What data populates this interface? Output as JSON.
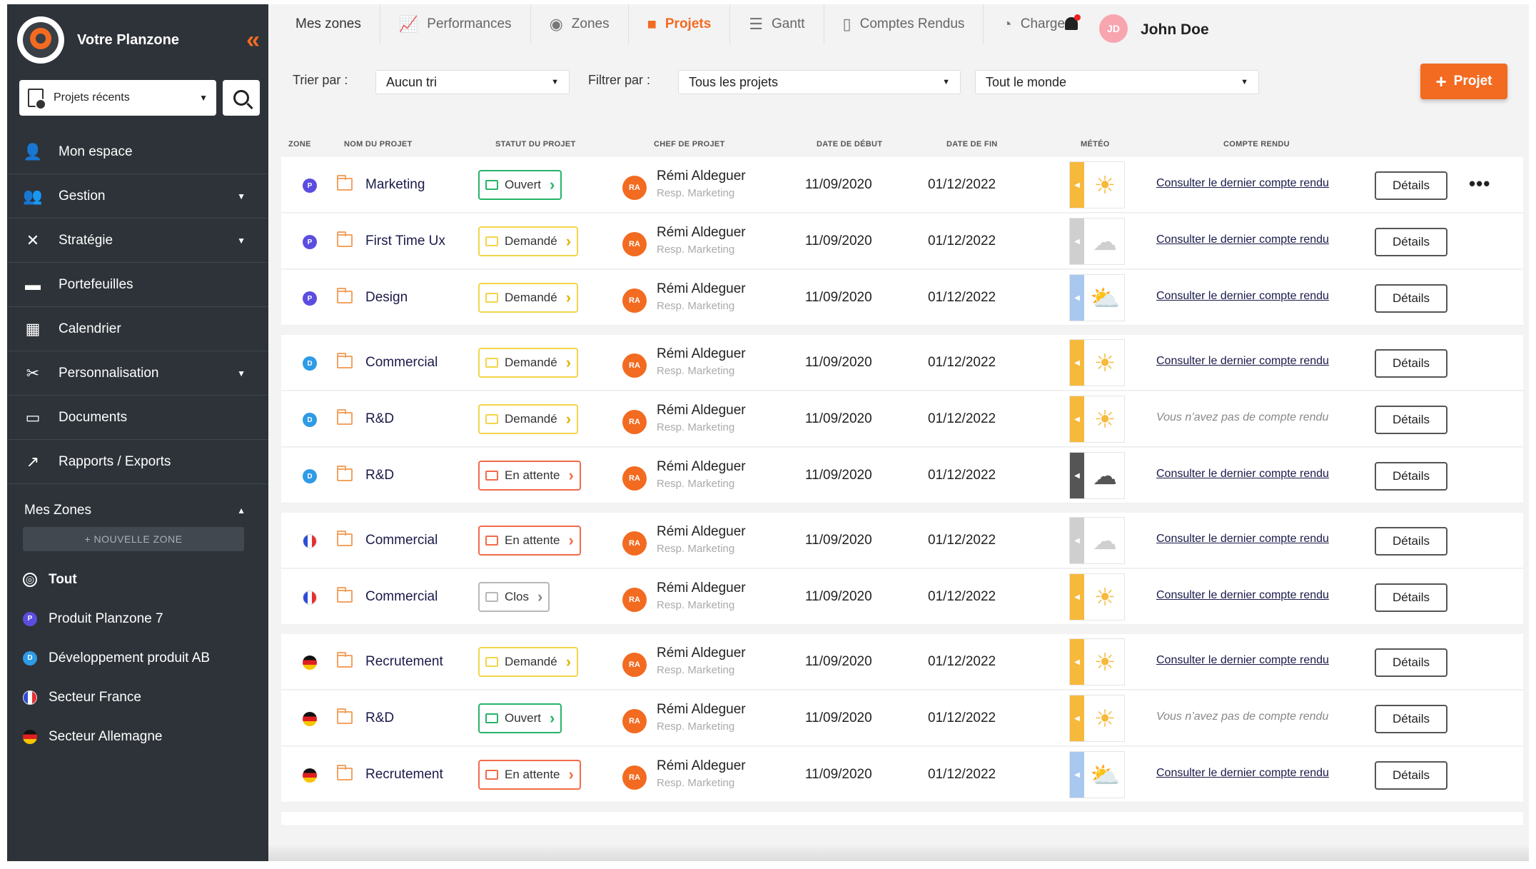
{
  "brand": {
    "name": "Votre Planzone"
  },
  "sidebar": {
    "recent_label": "Projets récents",
    "items": [
      {
        "label": "Mon espace",
        "icon": "user-lock-icon",
        "glyph": "👤",
        "dropdown": false
      },
      {
        "label": "Gestion",
        "icon": "users-cog-icon",
        "glyph": "👥",
        "dropdown": true
      },
      {
        "label": "Stratégie",
        "icon": "strategy-icon",
        "glyph": "✕",
        "dropdown": true
      },
      {
        "label": "Portefeuilles",
        "icon": "wallet-icon",
        "glyph": "▬",
        "dropdown": false
      },
      {
        "label": "Calendrier",
        "icon": "calendar-icon",
        "glyph": "▦",
        "dropdown": false
      },
      {
        "label": "Personnalisation",
        "icon": "tools-icon",
        "glyph": "✂",
        "dropdown": true
      },
      {
        "label": "Documents",
        "icon": "hdd-icon",
        "glyph": "▭",
        "dropdown": false
      },
      {
        "label": "Rapports / Exports",
        "icon": "export-icon",
        "glyph": "↗",
        "dropdown": false
      }
    ],
    "zones_title": "Mes Zones",
    "new_zone_label": "+ NOUVELLE ZONE",
    "zones": [
      {
        "label": "Tout",
        "badge": "",
        "color": "#2d3339",
        "kind": "all"
      },
      {
        "label": "Produit Planzone 7",
        "badge": "P",
        "color": "#5b4de0",
        "kind": "letter"
      },
      {
        "label": "Développement produit AB",
        "badge": "D",
        "color": "#2e9be6",
        "kind": "letter"
      },
      {
        "label": "Secteur France",
        "badge": "",
        "color": "",
        "kind": "flag-fr"
      },
      {
        "label": "Secteur Allemagne",
        "badge": "",
        "color": "",
        "kind": "flag-de"
      }
    ]
  },
  "topnav": {
    "tabs": [
      {
        "label": "Mes zones",
        "icon": "",
        "active": false
      },
      {
        "label": "Performances",
        "icon": "chart-line-icon",
        "glyph": "📈",
        "active": false
      },
      {
        "label": "Zones",
        "icon": "zones-icon",
        "glyph": "◉",
        "active": false
      },
      {
        "label": "Projets",
        "icon": "folder-icon",
        "glyph": "■",
        "active": true
      },
      {
        "label": "Gantt",
        "icon": "gantt-icon",
        "glyph": "☰",
        "active": false
      },
      {
        "label": "Comptes Rendus",
        "icon": "file-icon",
        "glyph": "▯",
        "active": false
      },
      {
        "label": "Charge",
        "icon": "gauge-icon",
        "glyph": "◔",
        "active": false
      }
    ],
    "user": {
      "initials": "JD",
      "name": "John Doe"
    }
  },
  "filters": {
    "sort_label": "Trier par :",
    "sort_value": "Aucun tri",
    "filter_label": "Filtrer par :",
    "filter_value": "Tous les projets",
    "people_value": "Tout le monde",
    "add_button": "Projet"
  },
  "table": {
    "headers": [
      "ZONE",
      "NOM DU PROJET",
      "STATUT DU PROJET",
      "CHEF DE PROJET",
      "DATE DE DÉBUT",
      "DATE DE FIN",
      "MÉTÉO",
      "COMPTE RENDU"
    ],
    "rows": [
      {
        "zone": "P",
        "zone_kind": "letter",
        "zone_color": "#5b4de0",
        "name": "Marketing",
        "status": "Ouvert",
        "status_color": "#27b36a",
        "chef_initials": "RA",
        "chef": "Rémi Aldeguer",
        "chef_role": "Resp. Marketing",
        "start": "11/09/2020",
        "end": "01/12/2022",
        "weather": "sun",
        "weather_color": "#f6b93b",
        "report": "Consulter le dernier compte rendu",
        "has_report": true,
        "details": "Détails",
        "more": "•••"
      },
      {
        "zone": "P",
        "zone_kind": "letter",
        "zone_color": "#5b4de0",
        "name": "First Time Ux",
        "status": "Demandé",
        "status_color": "#f2d54a",
        "chef_initials": "RA",
        "chef": "Rémi Aldeguer",
        "chef_role": "Resp. Marketing",
        "start": "11/09/2020",
        "end": "01/12/2022",
        "weather": "cloud",
        "weather_color": "#cfcfcf",
        "report": "Consulter le dernier compte rendu",
        "has_report": true,
        "details": "Détails",
        "more": ""
      },
      {
        "zone": "P",
        "zone_kind": "letter",
        "zone_color": "#5b4de0",
        "name": "Design",
        "status": "Demandé",
        "status_color": "#f2d54a",
        "chef_initials": "RA",
        "chef": "Rémi Aldeguer",
        "chef_role": "Resp. Marketing",
        "start": "11/09/2020",
        "end": "01/12/2022",
        "weather": "suncloud",
        "weather_color": "#a9c8f0",
        "report": "Consulter le dernier compte rendu",
        "has_report": true,
        "details": "Détails",
        "more": ""
      },
      {
        "zone": "D",
        "zone_kind": "letter",
        "zone_color": "#2e9be6",
        "name": "Commercial",
        "status": "Demandé",
        "status_color": "#f2d54a",
        "chef_initials": "RA",
        "chef": "Rémi Aldeguer",
        "chef_role": "Resp. Marketing",
        "start": "11/09/2020",
        "end": "01/12/2022",
        "weather": "sun",
        "weather_color": "#f6b93b",
        "report": "Consulter le dernier compte rendu",
        "has_report": true,
        "details": "Détails",
        "more": ""
      },
      {
        "zone": "D",
        "zone_kind": "letter",
        "zone_color": "#2e9be6",
        "name": "R&D",
        "status": "Demandé",
        "status_color": "#f2d54a",
        "chef_initials": "RA",
        "chef": "Rémi Aldeguer",
        "chef_role": "Resp. Marketing",
        "start": "11/09/2020",
        "end": "01/12/2022",
        "weather": "sun",
        "weather_color": "#f6b93b",
        "report": "Vous n’avez pas de compte rendu",
        "has_report": false,
        "details": "Détails",
        "more": ""
      },
      {
        "zone": "D",
        "zone_kind": "letter",
        "zone_color": "#2e9be6",
        "name": "R&D",
        "status": "En attente",
        "status_color": "#f26b4a",
        "chef_initials": "RA",
        "chef": "Rémi Aldeguer",
        "chef_role": "Resp. Marketing",
        "start": "11/09/2020",
        "end": "01/12/2022",
        "weather": "storm",
        "weather_color": "#555555",
        "report": "Consulter le dernier compte rendu",
        "has_report": true,
        "details": "Détails",
        "more": ""
      },
      {
        "zone": "",
        "zone_kind": "flag-fr",
        "zone_color": "",
        "name": "Commercial",
        "status": "En attente",
        "status_color": "#f26b4a",
        "chef_initials": "RA",
        "chef": "Rémi Aldeguer",
        "chef_role": "Resp. Marketing",
        "start": "11/09/2020",
        "end": "01/12/2022",
        "weather": "cloud",
        "weather_color": "#cfcfcf",
        "report": "Consulter le dernier compte rendu",
        "has_report": true,
        "details": "Détails",
        "more": ""
      },
      {
        "zone": "",
        "zone_kind": "flag-fr",
        "zone_color": "",
        "name": "Commercial",
        "status": "Clos",
        "status_color": "#b8b8b8",
        "chef_initials": "RA",
        "chef": "Rémi Aldeguer",
        "chef_role": "Resp. Marketing",
        "start": "11/09/2020",
        "end": "01/12/2022",
        "weather": "sun",
        "weather_color": "#f6b93b",
        "report": "Consulter le dernier compte rendu",
        "has_report": true,
        "details": "Détails",
        "more": ""
      },
      {
        "zone": "",
        "zone_kind": "flag-de",
        "zone_color": "",
        "name": "Recrutement",
        "status": "Demandé",
        "status_color": "#f2d54a",
        "chef_initials": "RA",
        "chef": "Rémi Aldeguer",
        "chef_role": "Resp. Marketing",
        "start": "11/09/2020",
        "end": "01/12/2022",
        "weather": "sun",
        "weather_color": "#f6b93b",
        "report": "Consulter le dernier compte rendu",
        "has_report": true,
        "details": "Détails",
        "more": ""
      },
      {
        "zone": "",
        "zone_kind": "flag-de",
        "zone_color": "",
        "name": "R&D",
        "status": "Ouvert",
        "status_color": "#27b36a",
        "chef_initials": "RA",
        "chef": "Rémi Aldeguer",
        "chef_role": "Resp. Marketing",
        "start": "11/09/2020",
        "end": "01/12/2022",
        "weather": "sun",
        "weather_color": "#f6b93b",
        "report": "Vous n’avez pas de compte rendu",
        "has_report": false,
        "details": "Détails",
        "more": ""
      },
      {
        "zone": "",
        "zone_kind": "flag-de",
        "zone_color": "",
        "name": "Recrutement",
        "status": "En attente",
        "status_color": "#f26b4a",
        "chef_initials": "RA",
        "chef": "Rémi Aldeguer",
        "chef_role": "Resp. Marketing",
        "start": "11/09/2020",
        "end": "01/12/2022",
        "weather": "suncloud",
        "weather_color": "#a9c8f0",
        "report": "Consulter le dernier compte rendu",
        "has_report": true,
        "details": "Détails",
        "more": ""
      }
    ]
  },
  "colors": {
    "accent": "#f26b21",
    "sidebar_bg": "#2d3339"
  }
}
